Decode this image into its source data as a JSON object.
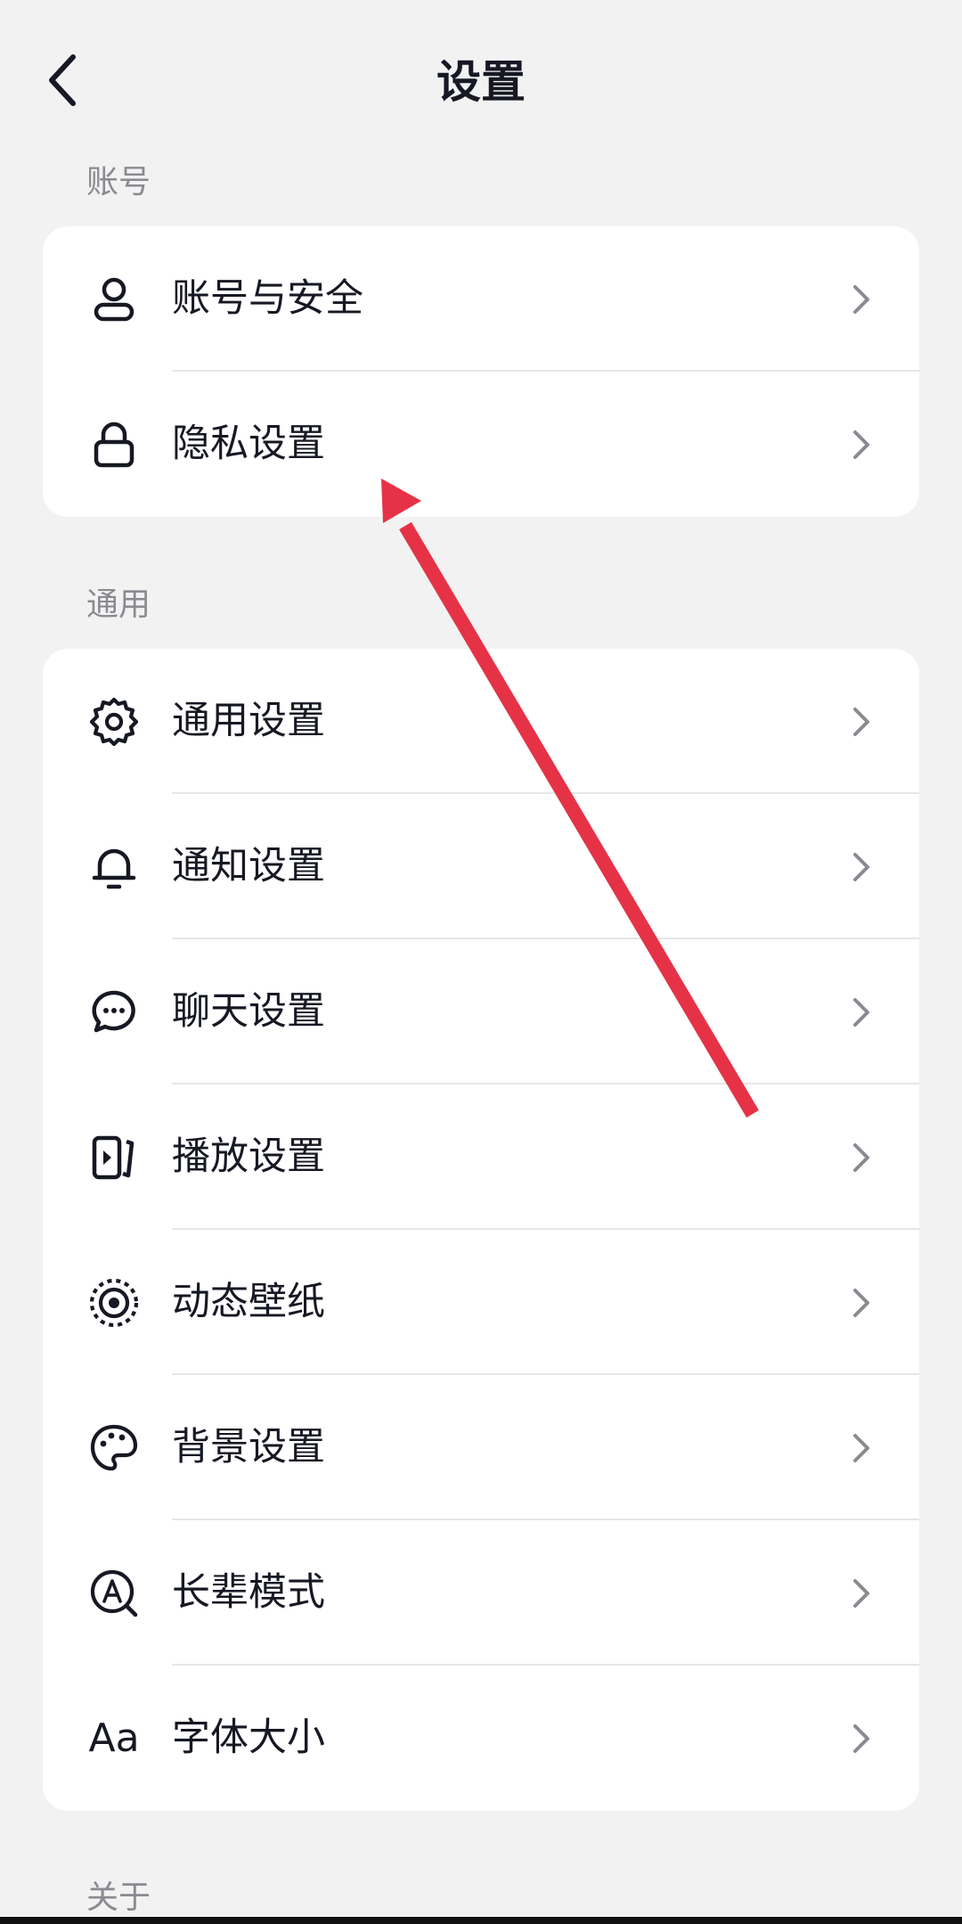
{
  "header": {
    "title": "设置",
    "back_icon": "chevron-left-icon"
  },
  "sections": {
    "account": {
      "label": "账号",
      "items": [
        {
          "label": "账号与安全",
          "icon": "user-icon"
        },
        {
          "label": "隐私设置",
          "icon": "lock-icon"
        }
      ]
    },
    "general": {
      "label": "通用",
      "items": [
        {
          "label": "通用设置",
          "icon": "gear-icon"
        },
        {
          "label": "通知设置",
          "icon": "bell-icon"
        },
        {
          "label": "聊天设置",
          "icon": "chat-bubble-icon"
        },
        {
          "label": "播放设置",
          "icon": "play-panel-icon"
        },
        {
          "label": "动态壁纸",
          "icon": "live-wallpaper-icon"
        },
        {
          "label": "背景设置",
          "icon": "palette-icon"
        },
        {
          "label": "长辈模式",
          "icon": "elder-mode-icon"
        },
        {
          "label": "字体大小",
          "icon": "font-size-icon",
          "glyph": "Aa"
        }
      ]
    },
    "about": {
      "label": "关于"
    }
  },
  "colors": {
    "background": "#f2f2f2",
    "card": "#ffffff",
    "text": "#161823",
    "secondary_text": "#8a8b91",
    "chevron": "#8a8b91",
    "annotation_arrow": "#e63246"
  }
}
